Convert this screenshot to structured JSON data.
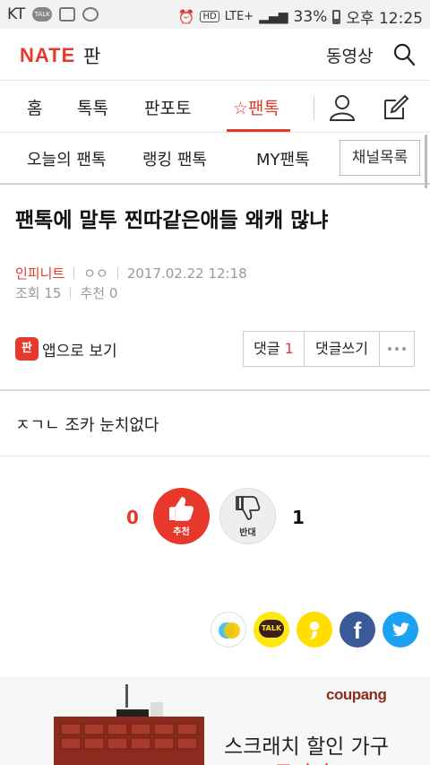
{
  "statusbar": {
    "carrier": "KT",
    "talk_badge": "TALK",
    "network": "LTE+",
    "battery": "33%",
    "time": "오후 12:25"
  },
  "header": {
    "logo": "NATE",
    "logo_sub": "판",
    "video_label": "동영상"
  },
  "nav": {
    "items": [
      {
        "label": "홈"
      },
      {
        "label": "톡톡"
      },
      {
        "label": "판포토"
      },
      {
        "label": "팬톡"
      }
    ],
    "active_index": 3
  },
  "subnav": {
    "items": [
      {
        "label": "오늘의 팬톡"
      },
      {
        "label": "랭킹 팬톡"
      },
      {
        "label": "MY팬톡"
      }
    ],
    "channel_list": "채널목록"
  },
  "post": {
    "title": "팬톡에 말투 찐따같은애들 왜캐 많냐",
    "author": "인피니트",
    "nickname": "ㅇㅇ",
    "datetime": "2017.02.22 12:18",
    "views_label": "조회",
    "views": "15",
    "likes_label": "추천",
    "likes": "0",
    "app_icon_text": "판",
    "app_view": "앱으로 보기",
    "comment_label": "댓글",
    "comment_count": "1",
    "write_comment": "댓글쓰기",
    "body": "ㅈㄱㄴ 조카 눈치없다"
  },
  "votes": {
    "up_count": "0",
    "up_label": "추천",
    "down_count": "1",
    "down_label": "반대"
  },
  "share": [
    {
      "icon": "kakaostory-icon",
      "color": "#f9c700"
    },
    {
      "icon": "kakaotalk-icon",
      "color": "#ffe812",
      "text": "TALK"
    },
    {
      "icon": "kakao-yellow-icon",
      "color": "#ffde00"
    },
    {
      "icon": "facebook-icon",
      "color": "#3b5998",
      "text": "f"
    },
    {
      "icon": "twitter-icon",
      "color": "#1da1f2"
    }
  ],
  "ad": {
    "brand": "coupang",
    "headline": "스크래치 할인 가구",
    "subline": "쿠팡가"
  },
  "colors": {
    "accent": "#e8382c"
  }
}
